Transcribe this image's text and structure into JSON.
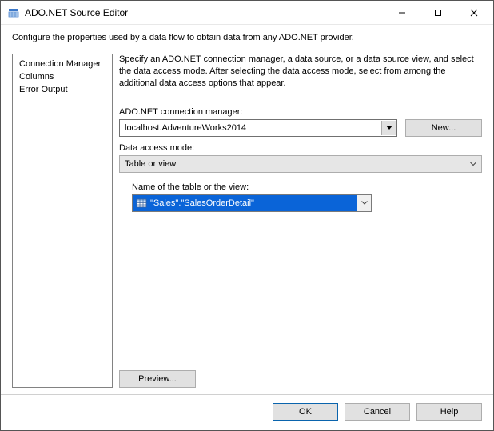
{
  "window": {
    "title": "ADO.NET Source Editor"
  },
  "intro": "Configure the properties used by a data flow to obtain data from any ADO.NET provider.",
  "sidebar": {
    "items": [
      {
        "label": "Connection Manager"
      },
      {
        "label": "Columns"
      },
      {
        "label": "Error Output"
      }
    ]
  },
  "main": {
    "instruction": "Specify an ADO.NET connection manager, a data source, or a data source view, and select the data access mode. After selecting the data access mode, select from among the additional data access options that appear.",
    "conn_label": "ADO.NET connection manager:",
    "conn_value": "localhost.AdventureWorks2014",
    "new_button": "New...",
    "mode_label": "Data access mode:",
    "mode_value": "Table or view",
    "table_label": "Name of the table or the view:",
    "table_value": "\"Sales\".\"SalesOrderDetail\"",
    "preview_button": "Preview..."
  },
  "footer": {
    "ok": "OK",
    "cancel": "Cancel",
    "help": "Help"
  }
}
